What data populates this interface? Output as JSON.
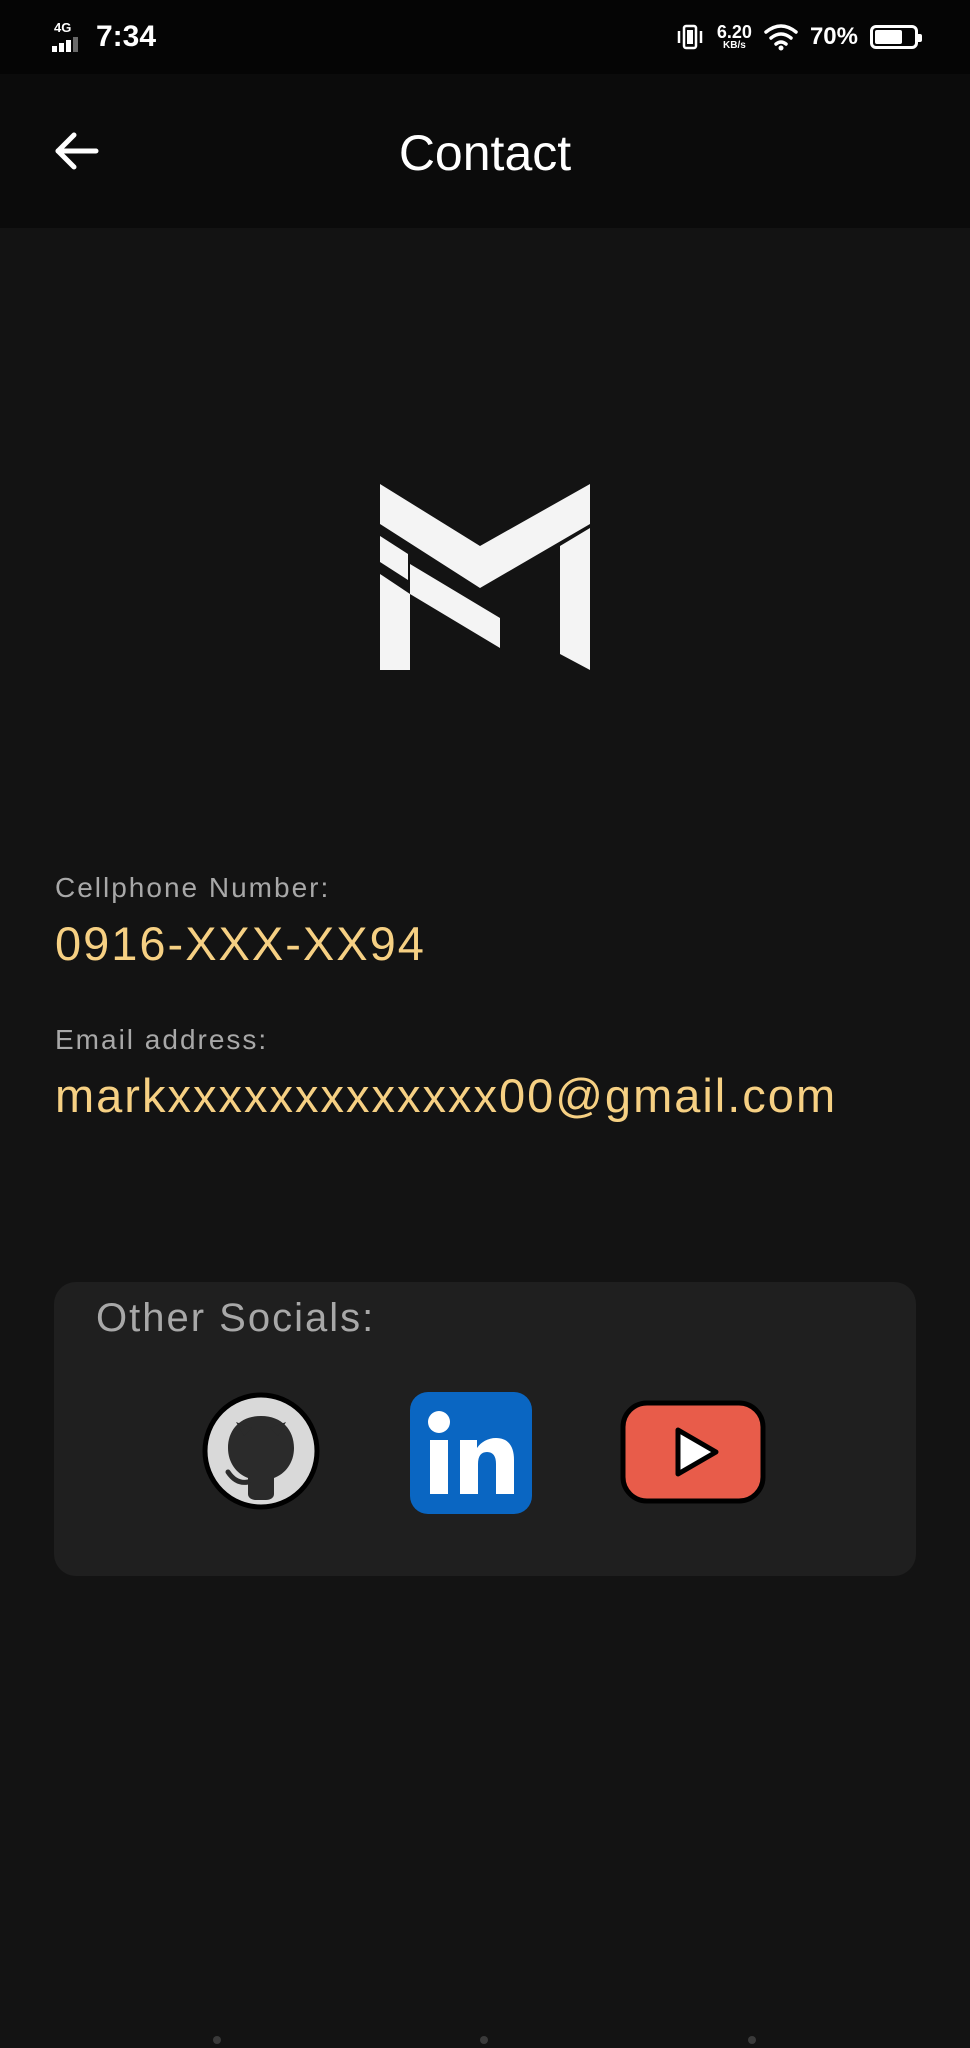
{
  "status_bar": {
    "network_label": "4G",
    "time": "7:34",
    "speed_value": "6.20",
    "speed_unit": "KB/s",
    "battery_percent": "70%",
    "battery_level": 0.7
  },
  "app_bar": {
    "title": "Contact",
    "back_icon": "arrow-left-icon"
  },
  "logo": {
    "icon": "monogram-m-logo"
  },
  "contact": {
    "phone_label": "Cellphone Number:",
    "phone_value": "0916-XXX-XX94",
    "email_label": "Email address:",
    "email_value": "markxxxxxxxxxxxxx00@gmail.com"
  },
  "socials": {
    "title": "Other Socials:",
    "items": [
      {
        "name": "GitHub",
        "icon": "github-icon"
      },
      {
        "name": "LinkedIn",
        "icon": "linkedin-icon",
        "text": "in",
        "color": "#0a66c2"
      },
      {
        "name": "YouTube",
        "icon": "youtube-icon",
        "color": "#e85c4a"
      }
    ]
  },
  "colors": {
    "background": "#131313",
    "app_bar": "#0b0b0b",
    "card": "#1f1f1f",
    "accent_value": "#f6d083",
    "label": "#a8a8a8"
  }
}
